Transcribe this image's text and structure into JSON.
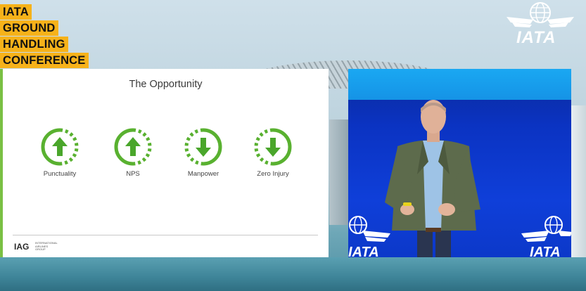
{
  "conference": {
    "lines": [
      "IATA",
      "GROUND",
      "HANDLING",
      "CONFERENCE"
    ]
  },
  "iata_logo": {
    "text": "IATA",
    "icon": "iata-globe-wings-icon"
  },
  "slide": {
    "title": "The Opportunity",
    "kpis": [
      {
        "label": "Punctuality",
        "direction": "up",
        "icon": "arrow-up-circle-icon"
      },
      {
        "label": "NPS",
        "direction": "up",
        "icon": "arrow-up-circle-icon"
      },
      {
        "label": "Manpower",
        "direction": "down",
        "icon": "arrow-down-circle-icon"
      },
      {
        "label": "Zero Injury",
        "direction": "down",
        "icon": "arrow-down-circle-icon"
      }
    ],
    "footer_logo": "IAG",
    "footer_logo_sub": "INTERNATIONAL AIRLINES GROUP",
    "accent_color": "#7ac043"
  },
  "stage": {
    "logo_text": "IATA",
    "background_color": "#0f3fd9"
  }
}
